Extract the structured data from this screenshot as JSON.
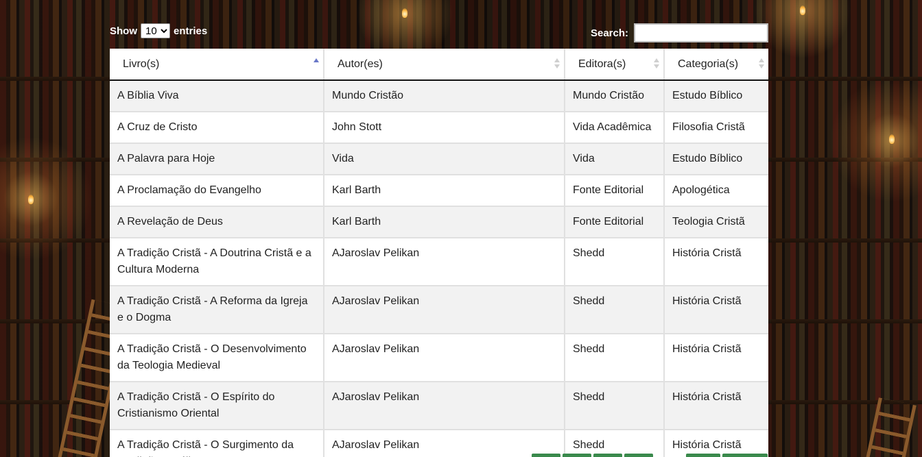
{
  "length_control": {
    "show_label": "Show",
    "selected": "10",
    "entries_label": "entries"
  },
  "search": {
    "label": "Search:",
    "value": ""
  },
  "table": {
    "columns": [
      {
        "label": "Livro(s)",
        "sort": "ascending"
      },
      {
        "label": "Autor(es)",
        "sort": "none"
      },
      {
        "label": "Editora(s)",
        "sort": "none"
      },
      {
        "label": "Categoria(s)",
        "sort": "none"
      }
    ],
    "rows": [
      {
        "livro": "A Bíblia Viva",
        "autor": "Mundo Cristão",
        "editora": "Mundo Cristão",
        "categoria": "Estudo Bíblico"
      },
      {
        "livro": "A Cruz de Cristo",
        "autor": "John Stott",
        "editora": "Vida Acadêmica",
        "categoria": "Filosofia Cristã"
      },
      {
        "livro": "A Palavra para Hoje",
        "autor": "Vida",
        "editora": "Vida",
        "categoria": "Estudo Bíblico"
      },
      {
        "livro": "A Proclamação do Evangelho",
        "autor": "Karl Barth",
        "editora": "Fonte Editorial",
        "categoria": "Apologética"
      },
      {
        "livro": "A Revelação de Deus",
        "autor": "Karl Barth",
        "editora": "Fonte Editorial",
        "categoria": "Teologia Cristã"
      },
      {
        "livro": "A Tradição Cristã - A Doutrina Cristã e a Cultura Moderna",
        "autor": "AJaroslav Pelikan",
        "editora": "Shedd",
        "categoria": "História Cristã"
      },
      {
        "livro": "A Tradição Cristã - A Reforma da Igreja e o Dogma",
        "autor": "AJaroslav Pelikan",
        "editora": "Shedd",
        "categoria": "História Cristã"
      },
      {
        "livro": "A Tradição Cristã - O Desenvolvimento da Teologia Medieval",
        "autor": "AJaroslav Pelikan",
        "editora": "Shedd",
        "categoria": "História Cristã"
      },
      {
        "livro": "A Tradição Cristã - O Espírito do Cristianismo Oriental",
        "autor": "AJaroslav Pelikan",
        "editora": "Shedd",
        "categoria": "História Cristã"
      },
      {
        "livro": "A Tradição Cristã - O Surgimento da Tradição Católica",
        "autor": "AJaroslav Pelikan",
        "editora": "Shedd",
        "categoria": "História Cristã"
      }
    ]
  },
  "colors": {
    "sort_active": "#6a78c8",
    "row_stripe": "#f2f2f2",
    "pagination_green": "#3a8a4c"
  }
}
